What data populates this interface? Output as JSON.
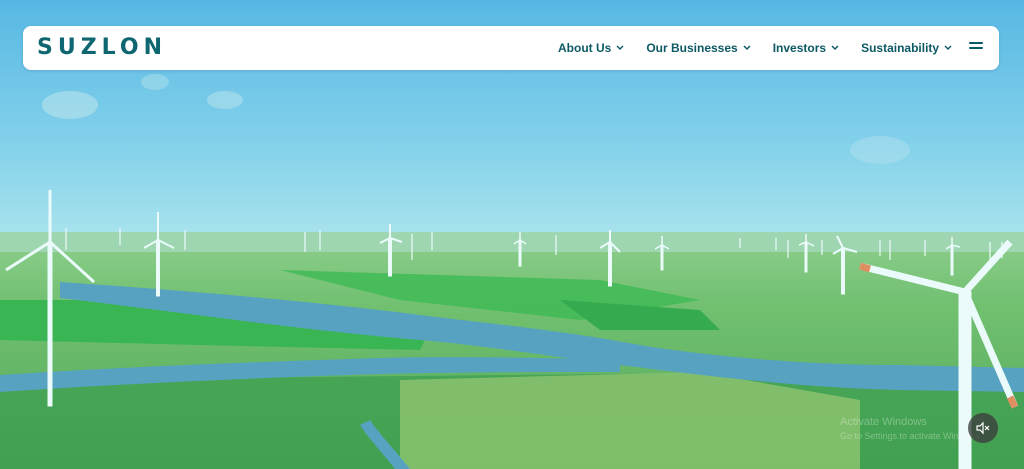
{
  "brand": {
    "logo_text": "SUZLON"
  },
  "nav": {
    "items": [
      {
        "label": "About Us"
      },
      {
        "label": "Our Businesses"
      },
      {
        "label": "Investors"
      },
      {
        "label": "Sustainability"
      }
    ],
    "menu_icon": "hamburger-icon"
  },
  "hero": {
    "description_icon": "wind-farm-video-background",
    "mute_icon": "speaker-muted-icon"
  },
  "watermark": {
    "line1": "Activate Windows",
    "line2": "Go to Settings to activate Windows"
  },
  "colors": {
    "brand": "#0d6670",
    "nav_text": "#0d5a66",
    "sky": "#7cc8ea",
    "grass": "#4fb04a",
    "river": "#4a8fb8"
  }
}
